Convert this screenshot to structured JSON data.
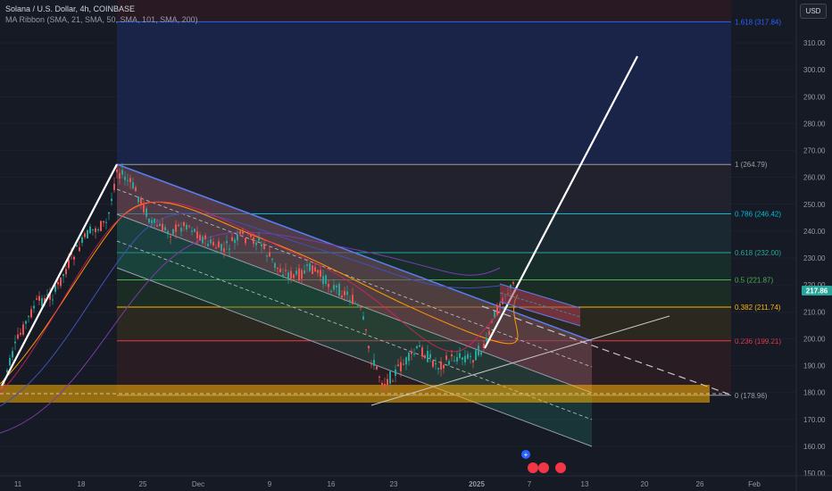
{
  "legend": {
    "symbol_line": "Solana / U.S. Dollar, 4h, COINBASE",
    "indicator_line": "MA Ribbon (SMA, 21, SMA, 50, SMA, 101, SMA, 200)"
  },
  "currency_button": "USD",
  "price_axis": {
    "ticks": [
      "310.00",
      "300.00",
      "290.00",
      "280.00",
      "270.00",
      "260.00",
      "250.00",
      "240.00",
      "230.00",
      "220.00",
      "210.00",
      "200.00",
      "190.00",
      "180.00",
      "170.00",
      "160.00",
      "150.00"
    ],
    "tick_values": [
      310,
      300,
      290,
      280,
      270,
      260,
      250,
      240,
      230,
      220,
      210,
      200,
      190,
      180,
      170,
      160,
      150
    ],
    "current_price": "217.86",
    "current_price_color": "#26a69a"
  },
  "fib_levels": [
    {
      "label": "1.618 (317.84)",
      "price": 317.84,
      "color": "#2962ff"
    },
    {
      "label": "1 (264.79)",
      "price": 264.79,
      "color": "#9e9e9e"
    },
    {
      "label": "0.786 (246.42)",
      "price": 246.42,
      "color": "#00bcd4"
    },
    {
      "label": "0.618 (232.00)",
      "price": 232.0,
      "color": "#26a69a"
    },
    {
      "label": "0.5 (221.87)",
      "price": 221.87,
      "color": "#4caf50"
    },
    {
      "label": "0.382 (211.74)",
      "price": 211.74,
      "color": "#ffb300"
    },
    {
      "label": "0.236 (199.21)",
      "price": 199.21,
      "color": "#f23645"
    },
    {
      "label": "0 (178.96)",
      "price": 178.96,
      "color": "#9e9e9e"
    }
  ],
  "time_axis": {
    "labels": [
      "11",
      "18",
      "25",
      "Dec",
      "9",
      "16",
      "23",
      "2025",
      "7",
      "13",
      "20",
      "26",
      "Feb"
    ]
  },
  "colors": {
    "background": "#161a25",
    "bull": "#26a69a",
    "bear": "#ef5350",
    "support_zone": "#ffb300",
    "channel_top": "#5b7cf0"
  }
}
